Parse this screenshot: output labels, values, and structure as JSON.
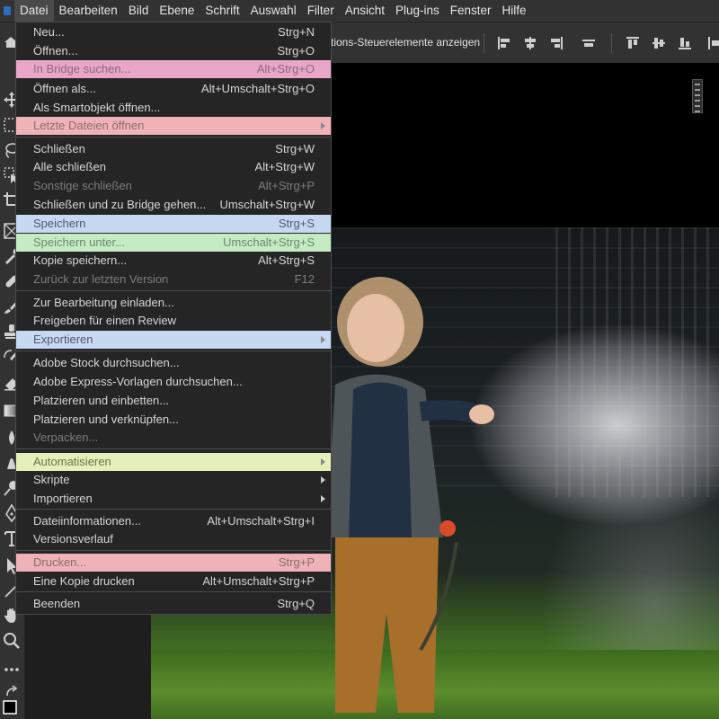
{
  "menubar": {
    "items": [
      "Datei",
      "Bearbeiten",
      "Bild",
      "Ebene",
      "Schrift",
      "Auswahl",
      "Filter",
      "Ansicht",
      "Plug-ins",
      "Fenster",
      "Hilfe"
    ],
    "active": "Datei"
  },
  "optionsbar": {
    "transform_label": "tions-Steuerelemente anzeigen"
  },
  "icons": {
    "home": "home-icon",
    "tools": [
      "move-tool-icon",
      "marquee-tool-icon",
      "lasso-tool-icon",
      "object-selection-icon",
      "crop-tool-icon",
      "frame-tool-icon",
      "eyedropper-tool-icon",
      "healing-brush-icon",
      "brush-tool-icon",
      "clone-stamp-icon",
      "history-brush-icon",
      "eraser-tool-icon",
      "gradient-tool-icon",
      "blur-tool-icon",
      "dodge-tool-icon",
      "pen-tool-icon",
      "type-tool-icon",
      "path-selection-icon",
      "line-tool-icon",
      "hand-tool-icon",
      "zoom-tool-icon",
      "more-tools-icon"
    ]
  },
  "colors": {
    "highlight_pink": "#e9a6c9",
    "highlight_salmon": "#efb3b7",
    "highlight_blue": "#c6d8f2",
    "highlight_green": "#c5ebc5",
    "highlight_yellow": "#e5efb9"
  },
  "file_menu": {
    "items": [
      {
        "label": "Neu...",
        "shortcut": "Strg+N"
      },
      {
        "label": "Öffnen...",
        "shortcut": "Strg+O"
      },
      {
        "label": "In Bridge suchen...",
        "shortcut": "Alt+Strg+O"
      },
      {
        "label": "Öffnen als...",
        "shortcut": "Alt+Umschalt+Strg+O"
      },
      {
        "label": "Als Smartobjekt öffnen...",
        "shortcut": ""
      },
      {
        "label": "Letzte Dateien öffnen",
        "shortcut": ""
      },
      {
        "label": "Schließen",
        "shortcut": "Strg+W"
      },
      {
        "label": "Alle schließen",
        "shortcut": "Alt+Strg+W"
      },
      {
        "label": "Sonstige schließen",
        "shortcut": "Alt+Strg+P"
      },
      {
        "label": "Schließen und zu Bridge gehen...",
        "shortcut": "Umschalt+Strg+W"
      },
      {
        "label": "Speichern",
        "shortcut": "Strg+S"
      },
      {
        "label": "Speichern unter...",
        "shortcut": "Umschalt+Strg+S"
      },
      {
        "label": "Kopie speichern...",
        "shortcut": "Alt+Strg+S"
      },
      {
        "label": "Zurück zur letzten Version",
        "shortcut": "F12"
      },
      {
        "label": "Zur Bearbeitung einladen...",
        "shortcut": ""
      },
      {
        "label": "Freigeben für einen Review",
        "shortcut": ""
      },
      {
        "label": "Exportieren",
        "shortcut": ""
      },
      {
        "label": "Adobe Stock durchsuchen...",
        "shortcut": ""
      },
      {
        "label": "Adobe Express-Vorlagen durchsuchen...",
        "shortcut": ""
      },
      {
        "label": "Platzieren und einbetten...",
        "shortcut": ""
      },
      {
        "label": "Platzieren und verknüpfen...",
        "shortcut": ""
      },
      {
        "label": "Verpacken...",
        "shortcut": ""
      },
      {
        "label": "Automatisieren",
        "shortcut": ""
      },
      {
        "label": "Skripte",
        "shortcut": ""
      },
      {
        "label": "Importieren",
        "shortcut": ""
      },
      {
        "label": "Dateiinformationen...",
        "shortcut": "Alt+Umschalt+Strg+I"
      },
      {
        "label": "Versionsverlauf",
        "shortcut": ""
      },
      {
        "label": "Drucken...",
        "shortcut": "Strg+P"
      },
      {
        "label": "Eine Kopie drucken",
        "shortcut": "Alt+Umschalt+Strg+P"
      },
      {
        "label": "Beenden",
        "shortcut": "Strg+Q"
      }
    ]
  }
}
